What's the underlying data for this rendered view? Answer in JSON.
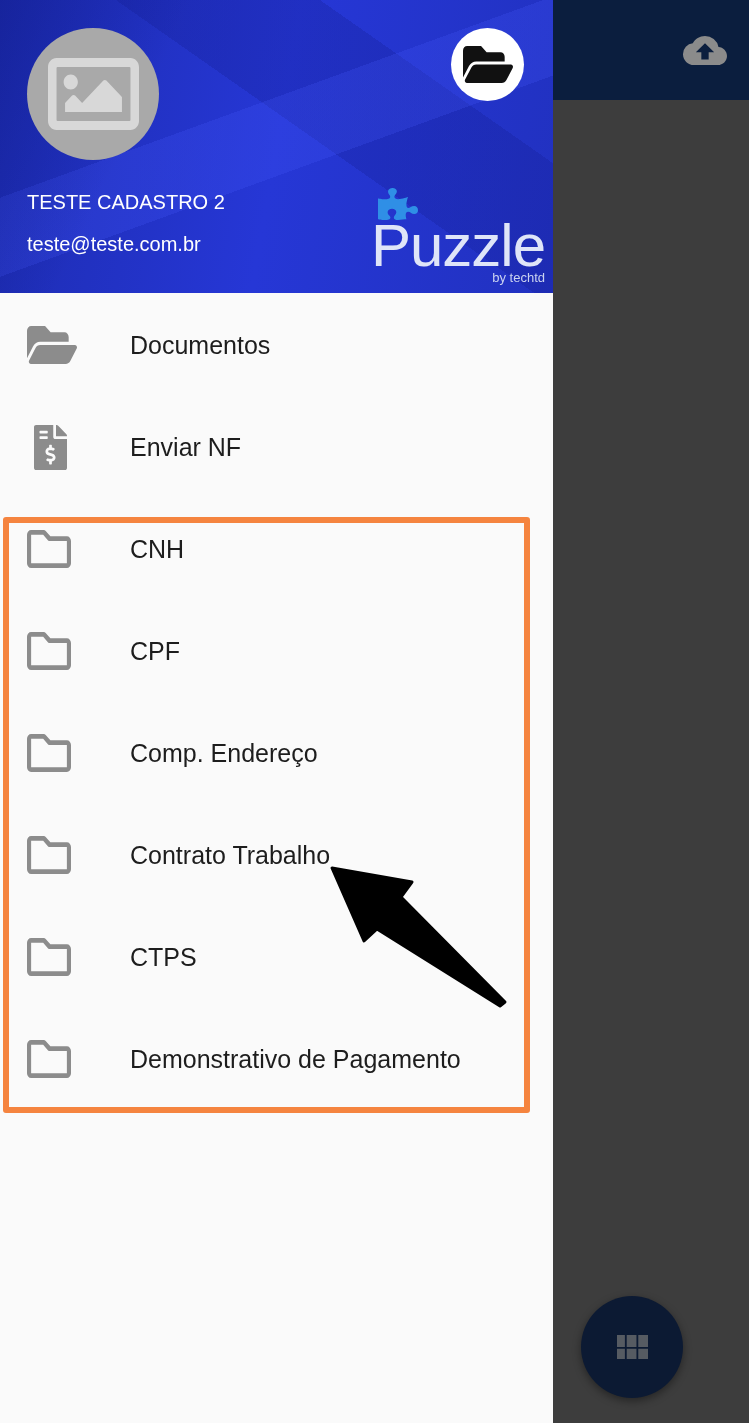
{
  "drawer": {
    "header": {
      "user_name": "TESTE CADASTRO 2",
      "email": "teste@teste.com.br",
      "logo": {
        "wordmark": "Puzzle",
        "tagline": "by techtd"
      }
    },
    "menu": [
      {
        "kind": "folder-open",
        "label": "Documentos"
      },
      {
        "kind": "invoice",
        "label": "Enviar NF"
      }
    ],
    "highlighted_group": {
      "items": [
        {
          "kind": "folder",
          "label": "CNH",
          "pointed": false
        },
        {
          "kind": "folder",
          "label": "CPF",
          "pointed": false
        },
        {
          "kind": "folder",
          "label": "Comp. Endereço",
          "pointed": false
        },
        {
          "kind": "folder",
          "label": "Contrato Trabalho",
          "pointed": true
        },
        {
          "kind": "folder",
          "label": "CTPS",
          "pointed": false
        },
        {
          "kind": "folder",
          "label": "Demonstrativo de Pagamento",
          "pointed": false
        }
      ]
    }
  }
}
